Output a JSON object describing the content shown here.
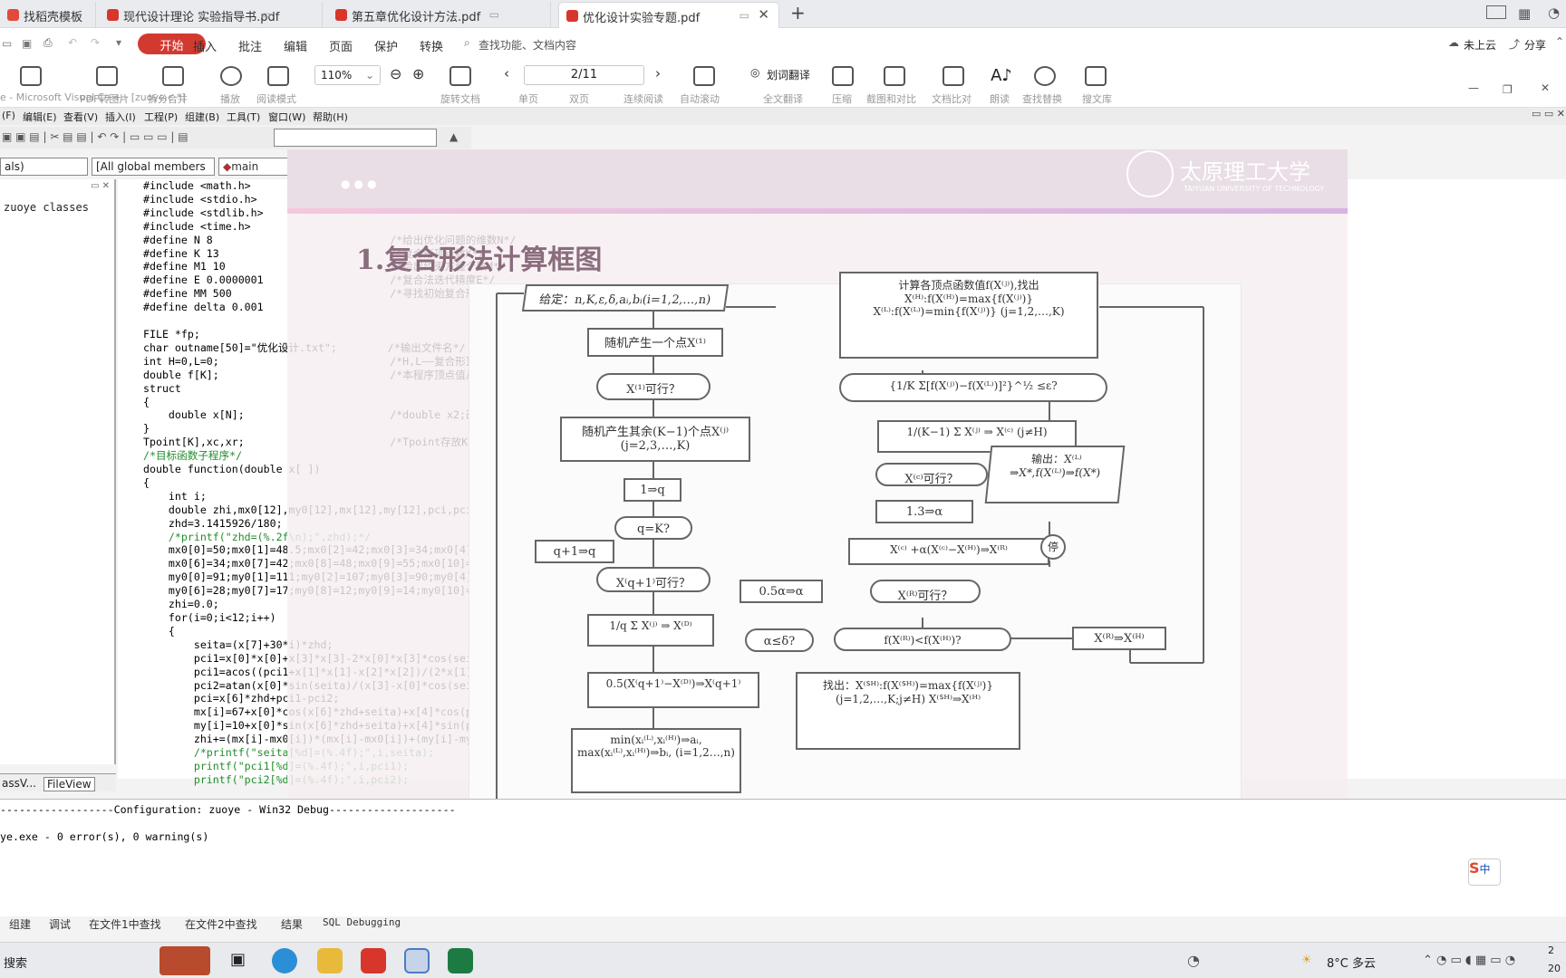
{
  "tabs": [
    {
      "label": "找稻壳模板"
    },
    {
      "label": "现代设计理论 实验指导书.pdf"
    },
    {
      "label": "第五章优化设计方法.pdf"
    },
    {
      "label": "优化设计实验专题.pdf",
      "active": true
    }
  ],
  "menu": {
    "items": [
      "开始",
      "插入",
      "批注",
      "编辑",
      "页面",
      "保护",
      "转换"
    ],
    "search_placeholder": "查找功能、文档内容",
    "cloud": "未上云",
    "share": "分享"
  },
  "ribbon": {
    "zoom": "110%",
    "page": "2/11",
    "translate": "划词翻译",
    "buttons": [
      "PDF转Office",
      "PDF转图片",
      "拆分合并",
      "播放",
      "阅读模式",
      "旋转文档",
      "单页",
      "双页",
      "连续阅读",
      "自动滚动",
      "全文翻译",
      "压缩",
      "截图和对比",
      "文档比对",
      "朗读",
      "查找替换",
      "搜文库"
    ]
  },
  "vc": {
    "title": "e - Microsoft Visual C++ - [zuoye.c *]",
    "menus": [
      "(F)",
      "编辑(E)",
      "查看(V)",
      "插入(I)",
      "工程(P)",
      "组建(B)",
      "工具(T)",
      "窗口(W)",
      "帮助(H)"
    ],
    "combo_scope": "als)",
    "combo_members": "[All global members",
    "combo_func": "main",
    "tree_label": "zuoye classes",
    "pane_tabs": [
      "assV...",
      "FileView"
    ],
    "code_lines": [
      "#include <math.h>",
      "#include <stdio.h>",
      "#include <stdlib.h>",
      "#include <time.h>",
      "#define N 8                            /*给出优化问题的维数N*/",
      "#define K 13                           /*复合形顶点数K*/",
      "#define M1 10                          /*给出约束方程个数M*/",
      "#define E 0.0000001                    /*复合法迭代精度E*/",
      "#define MM 500                         /*寻找初始复合形的最大次数MM*/",
      "#define delta 0.001",
      "",
      "FILE *fp;",
      "char outname[50]=\"优化设计.txt\";        /*输出文件名*/",
      "int H=0,L=0;                           /*H,L——复合形顶点最大和最小顶点号*/",
      "double f[K];                           /*本程序顶点值从f[0]开始*/",
      "struct",
      "{",
      "    double x[N];                       /*double x2;改为数组方式*/",
      "}",
      "Tpoint[K],xc,xr;                       /*Tpoint存放K个点的坐标，xc、xr分别为中心点和影射点坐标*/",
      "/*目标函数子程序*/",
      "double function(double x[ ])",
      "{",
      "    int i;",
      "    double zhi,mx0[12],my0[12],mx[12],my[12],pci,pci1,pci2,zhd,seita;",
      "    zhd=3.1415926/180;",
      "    /*printf(\"zhd=(%.2f\\n);\",zhd);*/",
      "    mx0[0]=50;mx0[1]=48.5;mx0[2]=42;mx0[3]=34;mx0[4]=29;mx0[5]=30;",
      "    mx0[6]=34;mx0[7]=42;mx0[8]=48;mx0[9]=55;mx0[10]=56;mx0[11]=51;",
      "    my0[0]=91;my0[1]=111;my0[2]=107;my0[3]=90;my0[4]=67;my0[5]=45;",
      "    my0[6]=28;my0[7]=17;my0[8]=12;my0[9]=14;my0[10]=24;my0[11]=52;",
      "    zhi=0.0;",
      "    for(i=0;i<12;i++)",
      "    {",
      "        seita=(x[7]+30*i)*zhd;",
      "        pci1=x[0]*x[0]+x[3]*x[3]-2*x[0]*x[3]*cos(seita);",
      "        pci1=acos((pci1+x[1]*x[1]-x[2]*x[2])/(2*x[1]*sqrt(pci1)));",
      "        pci2=atan(x[0]*sin(seita)/(x[3]-x[0]*cos(seita)));",
      "        pci=x[6]*zhd+pci1-pci2;",
      "        mx[i]=67+x[0]*cos(x[6]*zhd+seita)+x[4]*cos(pci+x[5]*zhd);",
      "        my[i]=10+x[0]*sin(x[6]*zhd+seita)+x[4]*sin(pci+x[5]*zhd);",
      "        zhi+=(mx[i]-mx0[i])*(mx[i]-mx0[i])+(my[i]-my0[i])*(my[i]-my0[i]);",
      "        /*printf(\"seita[%d]=(%.4f);\",i,seita);",
      "        printf(\"pci1[%d]=(%.4f);\",i,pci1);",
      "        printf(\"pci2[%d]=(%.4f);\",i,pci2);"
    ],
    "output_lines": [
      "------------------Configuration: zuoye - Win32 Debug--------------------",
      "",
      "ye.exe - 0 error(s), 0 warning(s)"
    ],
    "output_tabs": [
      "组建",
      "调试",
      "在文件1中查找",
      "在文件2中查找",
      "结果",
      "SQL Debugging"
    ]
  },
  "slide": {
    "title": "1.复合形法计算框图",
    "logo_cn": "太原理工大学",
    "logo_en": "TAIYUAN UNIVERSITY OF TECHNOLOGY",
    "flow": {
      "given": "给定：n,K,ε,δ,aᵢ,bᵢ(i=1,2,…,n)",
      "rand": "随机产生一个点X⁽¹⁾",
      "feasible": "X⁽¹⁾可行？",
      "gen_rest": "随机产生其余(K−1)个点X⁽ʲ⁾(j=2,3,…,K)",
      "q1": "1⇒q",
      "qk": "q=K?",
      "q_inc": "q+1⇒q",
      "xq_feas": "X⁽q+1⁾可行？",
      "centroid": "1/q Σ X⁽ʲ⁾ ⇒ X⁽ᴰ⁾",
      "half": "0.5(X⁽q+1⁾−X⁽ᴰ⁾)⇒X⁽q+1⁾",
      "minmax": "min(xᵢ⁽ᴸ⁾,xᵢ⁽ᴴ⁾)⇒aᵢ, max(xᵢ⁽ᴸ⁾,xᵢ⁽ᴴ⁾)⇒bᵢ, (i=1,2…,n)",
      "calc": "计算各顶点函数值f(X⁽ʲ⁾),找出 X⁽ᴴ⁾:f(X⁽ᴴ⁾)=max{f(X⁽ʲ⁾)} X⁽ᴸ⁾:f(X⁽ᴸ⁾)=min{f(X⁽ʲ⁾)} (j=1,2,…,K)",
      "conv": "{1/K Σ[f(X⁽ʲ⁾)−f(X⁽ᴸ⁾)]²}^½ ≤ε?",
      "center": "1/(K−1) Σ X⁽ʲ⁾ ⇒ X⁽ᶜ⁾ (j≠H)",
      "xc_feas": "X⁽ᶜ⁾可行？",
      "alpha": "1.3⇒α",
      "reflect": "X⁽ᶜ⁾ +α(X⁽ᶜ⁾−X⁽ᴴ⁾)⇒X⁽ᴿ⁾",
      "xr_feas": "X⁽ᴿ⁾可行？",
      "half_alpha": "0.5α⇒α",
      "cmp": "f(X⁽ᴿ⁾)<f(X⁽ᴴ⁾)?",
      "alpha_le": "α≤δ?",
      "replace": "X⁽ᴿ⁾⇒X⁽ᴴ⁾",
      "output": "输出：X⁽ᴸ⁾⇒X*,f(X⁽ᴸ⁾)⇒f(X*)",
      "stop": "停",
      "find_sh": "找出：X⁽ᔆᴴ⁾:f(X⁽ᔆᴴ⁾)=max{f(X⁽ʲ⁾)} (j=1,2,…,K;j≠H) X⁽ᔆᴴ⁾⇒X⁽ᴴ⁾"
    }
  },
  "taskbar": {
    "search": "搜索",
    "weather": "8°C 多云",
    "clock_time": "2",
    "clock_date": "20",
    "ime": "中"
  },
  "colors": {
    "accent": "#d23a30",
    "keyword": "#1a1ab8",
    "comment": "#238c2d"
  }
}
